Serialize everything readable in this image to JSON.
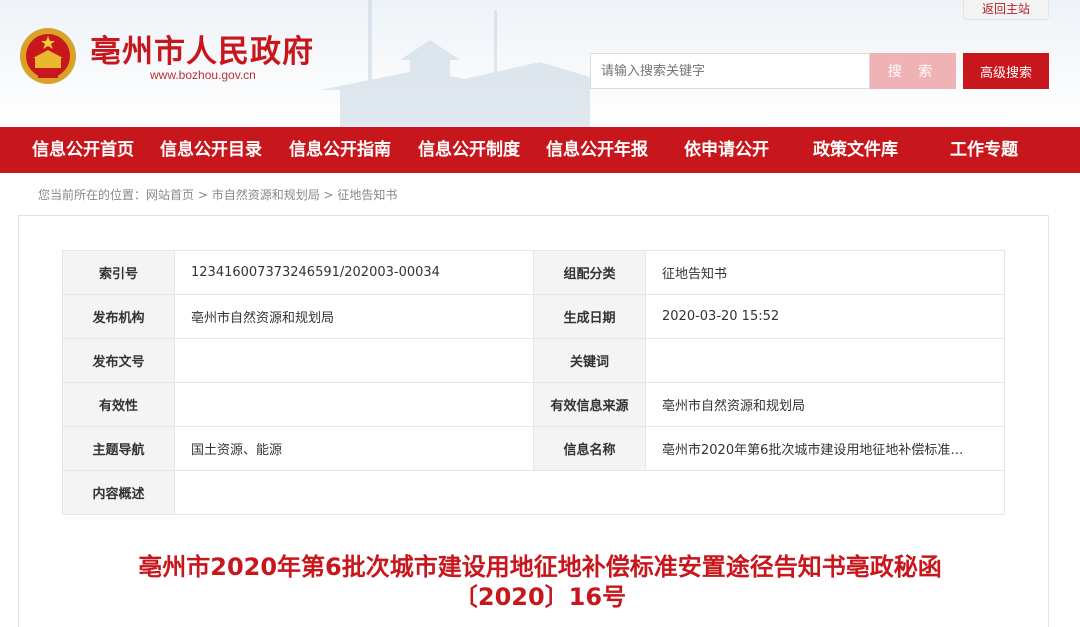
{
  "header": {
    "return_home": "返回主站",
    "site_title": "亳州市人民政府",
    "site_url": "www.bozhou.gov.cn",
    "search_placeholder": "请输入搜索关键字",
    "search_button": "搜 索",
    "advanced_search_button": "高级搜索"
  },
  "nav": {
    "items": [
      "信息公开首页",
      "信息公开目录",
      "信息公开指南",
      "信息公开制度",
      "信息公开年报",
      "依申请公开",
      "政策文件库",
      "工作专题"
    ]
  },
  "breadcrumb": {
    "prefix": "您当前所在的位置：",
    "items": [
      "网站首页",
      "市自然资源和规划局",
      "征地告知书"
    ],
    "separator": " > "
  },
  "info_table": {
    "rows": [
      {
        "label1": "索引号",
        "value1": "123416007373246591/202003-00034",
        "label2": "组配分类",
        "value2": "征地告知书"
      },
      {
        "label1": "发布机构",
        "value1": "亳州市自然资源和规划局",
        "label2": "生成日期",
        "value2": "2020-03-20 15:52"
      },
      {
        "label1": "发布文号",
        "value1": "",
        "label2": "关键词",
        "value2": ""
      },
      {
        "label1": "有效性",
        "value1": "",
        "label2": "有效信息来源",
        "value2": "亳州市自然资源和规划局"
      },
      {
        "label1": "主题导航",
        "value1": "国土资源、能源",
        "label2": "信息名称",
        "value2": "亳州市2020年第6批次城市建设用地征地补偿标准…"
      },
      {
        "label1": "内容概述",
        "value1": ""
      }
    ]
  },
  "article": {
    "title_line1": "亳州市2020年第6批次城市建设用地征地补偿标准安置途径告知书亳政秘函",
    "title_line2": "〔2020〕16号"
  },
  "colors": {
    "brand_red": "#c8161d",
    "search_button_pink": "#f0b3b5",
    "label_bg": "#f4f4f4"
  }
}
